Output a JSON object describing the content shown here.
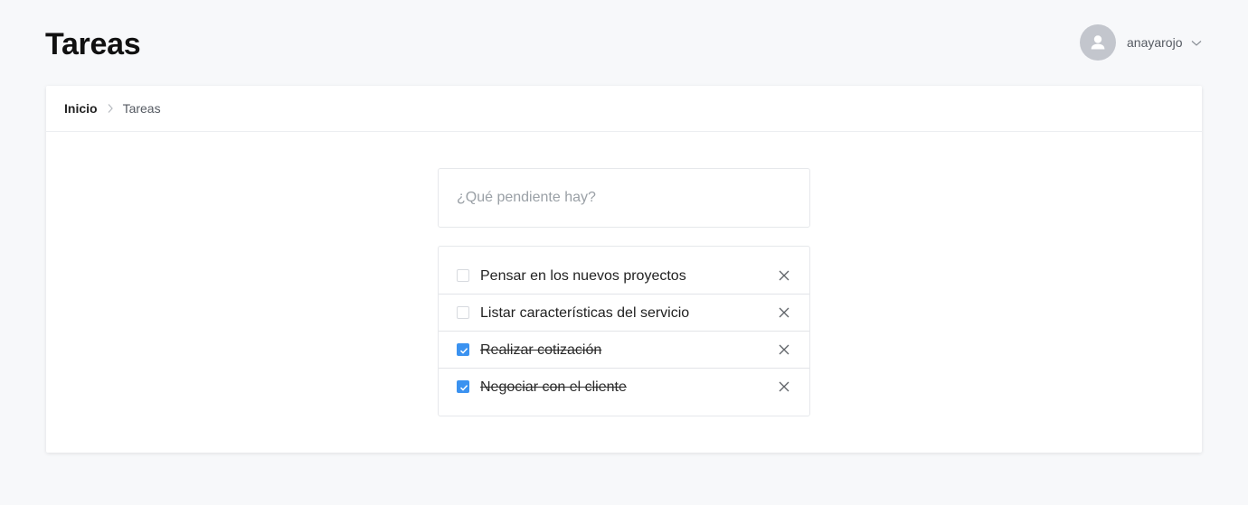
{
  "header": {
    "title": "Tareas",
    "username": "anayarojo"
  },
  "breadcrumb": {
    "home": "Inicio",
    "current": "Tareas"
  },
  "new_task": {
    "placeholder": "¿Qué pendiente hay?",
    "value": ""
  },
  "tasks": [
    {
      "label": "Pensar en los nuevos proyectos",
      "completed": false
    },
    {
      "label": "Listar características del servicio",
      "completed": false
    },
    {
      "label": "Realizar cotización",
      "completed": true
    },
    {
      "label": "Negociar con el cliente",
      "completed": true
    }
  ],
  "colors": {
    "accent": "#3b92f0",
    "background": "#f7f8fa",
    "avatar": "#c3c6cd"
  },
  "icons": {
    "avatar": "user-icon",
    "menu": "chevron-down-icon",
    "separator": "chevron-right-icon",
    "delete": "close-icon",
    "check": "check-icon"
  }
}
